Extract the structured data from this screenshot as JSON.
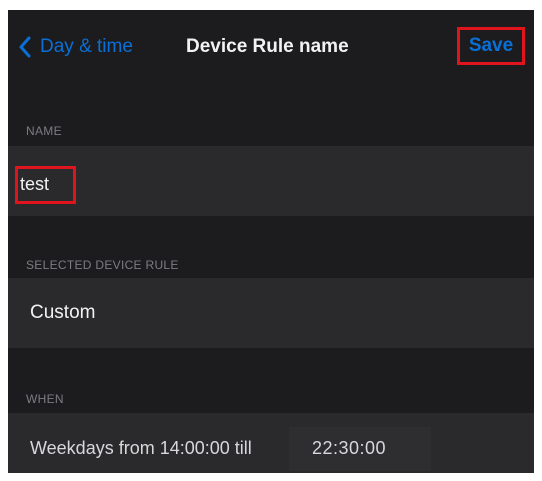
{
  "navbar": {
    "back_label": "Day & time",
    "title": "Device Rule name",
    "save_label": "Save"
  },
  "name_section": {
    "header": "NAME",
    "value": "test"
  },
  "rule_section": {
    "header": "SELECTED DEVICE RULE",
    "value": "Custom"
  },
  "when_section": {
    "header": "WHEN",
    "text": "Weekdays from 14:00:00 till",
    "end_time": "22:30:00"
  },
  "colors": {
    "background": "#1c1c1e",
    "row": "#2a2a2c",
    "accent": "#0a6fd6",
    "highlight": "#e0141c"
  },
  "icons": {
    "back": "chevron-left-icon"
  }
}
